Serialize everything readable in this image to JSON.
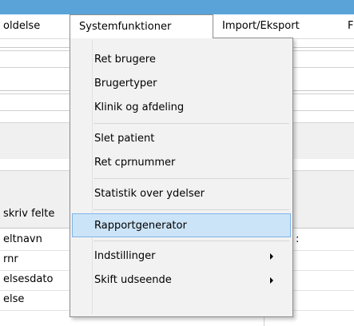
{
  "menubar": {
    "items": [
      {
        "label": "oldelse"
      },
      {
        "label": "Systemfunktioner"
      },
      {
        "label": "Import/Eksport"
      },
      {
        "label": "F"
      }
    ]
  },
  "form": {
    "labels": [
      {
        "text": "skriv felte"
      },
      {
        "text": "eltnavn"
      },
      {
        "text": "rnr"
      },
      {
        "text": "elsesdato"
      },
      {
        "text": "else"
      }
    ],
    "right_fragment": ":"
  },
  "dropdown": {
    "items": [
      {
        "label": "Ret brugere"
      },
      {
        "label": "Brugertyper"
      },
      {
        "label": "Klinik og afdeling"
      },
      {
        "label": "Slet patient"
      },
      {
        "label": "Ret cprnummer"
      },
      {
        "label": "Statistik over ydelser"
      },
      {
        "label": "Rapportgenerator"
      },
      {
        "label": "Indstillinger"
      },
      {
        "label": "Skift udseende"
      }
    ]
  },
  "colors": {
    "title_strip": "#59a3d9",
    "menu_background": "#f2f2f2",
    "highlight_fill": "#cce4f7",
    "highlight_border": "#7eb4ea"
  },
  "icons": {
    "submenu_arrow": "triangle-right"
  }
}
